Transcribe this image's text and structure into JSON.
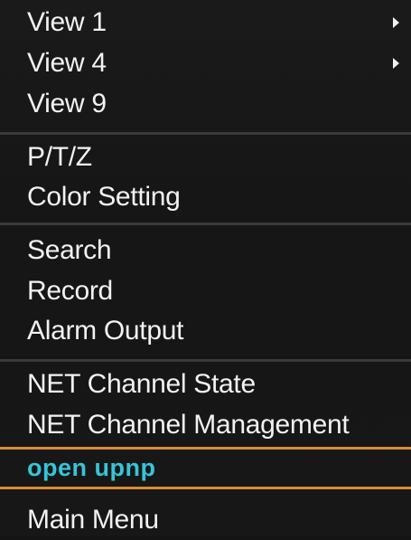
{
  "menu": {
    "items": [
      {
        "label": "View 1",
        "has_submenu": true
      },
      {
        "label": "View 4",
        "has_submenu": true
      },
      {
        "label": "View 9",
        "has_submenu": false
      },
      {
        "label": "P/T/Z",
        "has_submenu": false
      },
      {
        "label": "Color Setting",
        "has_submenu": false
      },
      {
        "label": "Search",
        "has_submenu": false
      },
      {
        "label": "Record",
        "has_submenu": false
      },
      {
        "label": "Alarm Output",
        "has_submenu": false
      },
      {
        "label": "NET Channel State",
        "has_submenu": false
      },
      {
        "label": "NET Channel Management",
        "has_submenu": false
      },
      {
        "label": "open upnp",
        "has_submenu": false,
        "selected": true
      },
      {
        "label": "Main Menu",
        "has_submenu": false
      }
    ]
  },
  "colors": {
    "text": "#f2f2f2",
    "selected_text": "#39c3d6",
    "selection_border": "#d98a3a",
    "background": "#171717",
    "divider": "#3a3a3a"
  }
}
